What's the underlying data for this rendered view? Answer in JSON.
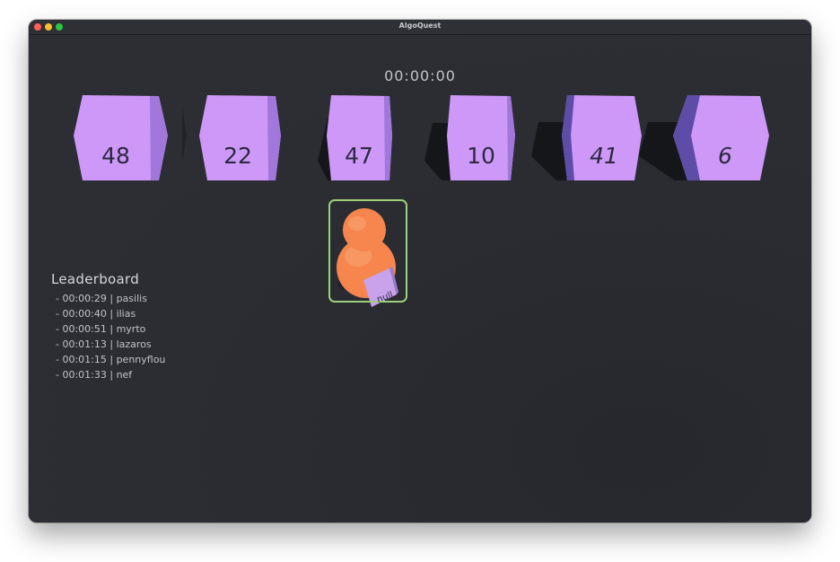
{
  "window": {
    "title": "AlgoQuest"
  },
  "hud": {
    "timer": "00:00:00"
  },
  "boxes": [
    {
      "value": "48"
    },
    {
      "value": "22"
    },
    {
      "value": "47"
    },
    {
      "value": "10"
    },
    {
      "value": "41"
    },
    {
      "value": "6"
    }
  ],
  "player": {
    "held_value": "null"
  },
  "leaderboard": {
    "title": "Leaderboard",
    "entries": [
      {
        "text": "- 00:00:29 | pasilis"
      },
      {
        "text": "- 00:00:40 | ilias"
      },
      {
        "text": "- 00:00:51 | myrto"
      },
      {
        "text": "- 00:01:13 | lazaros"
      },
      {
        "text": "- 00:01:15 | pennyflou"
      },
      {
        "text": "- 00:01:33 | nef"
      }
    ]
  },
  "colors": {
    "box_front": "#cd98f8",
    "box_top": "#dca8ff",
    "box_side_right": "#a277dc",
    "box_side_left": "#5e4da6",
    "player_body": "#f6864e",
    "selection_outline": "#9dd07a"
  }
}
